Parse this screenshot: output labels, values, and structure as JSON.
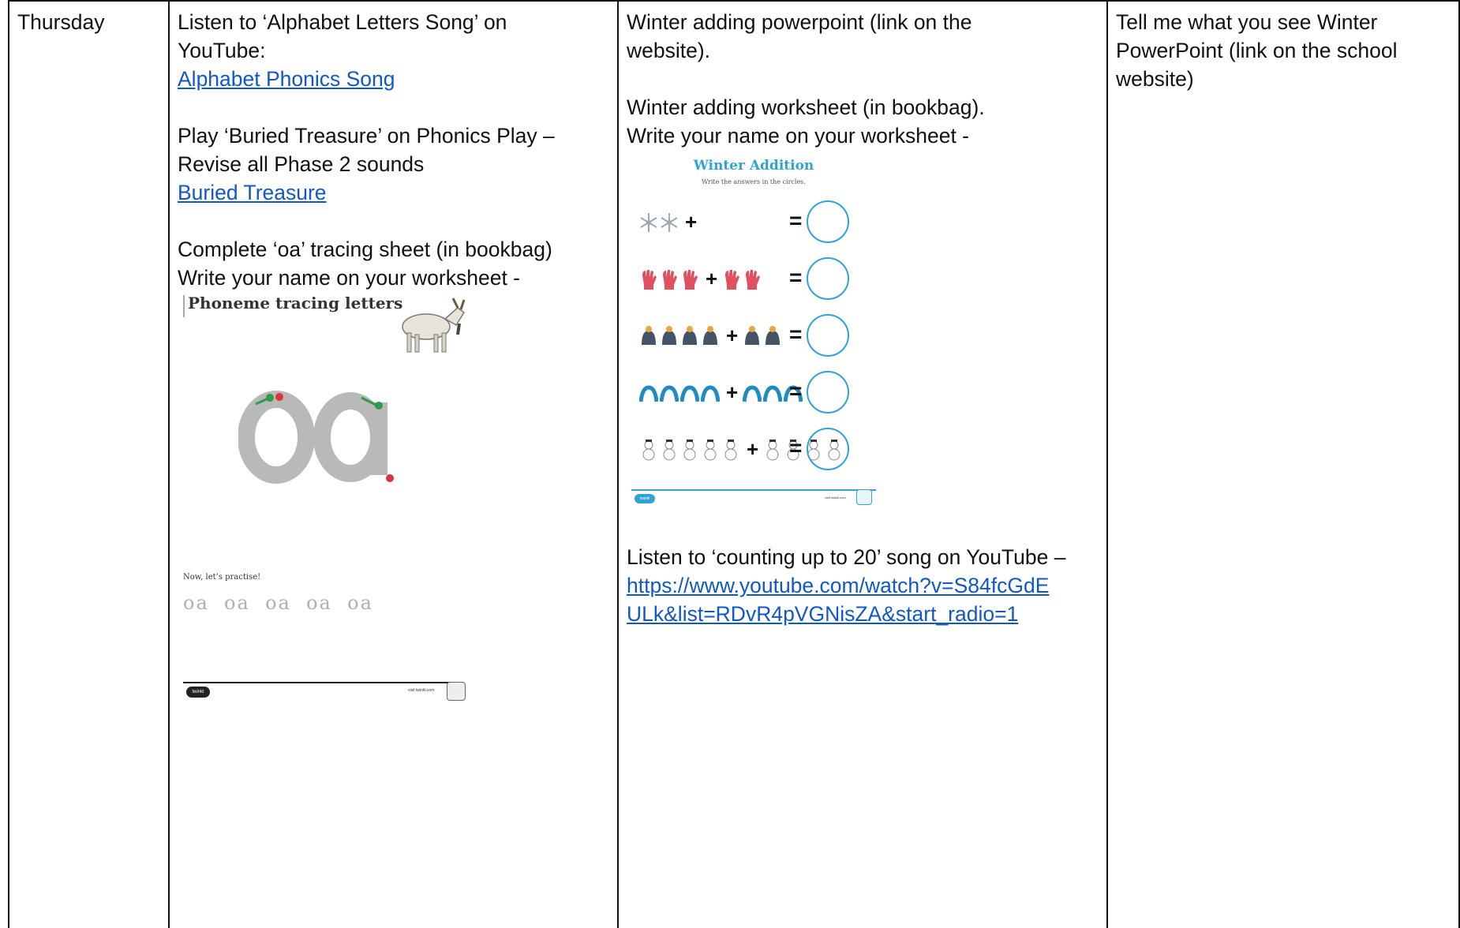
{
  "day": "Thursday",
  "phonics": {
    "line1": "Listen to ‘Alphabet Letters Song’ on",
    "line2": "YouTube:",
    "link1": "Alphabet Phonics Song",
    "line3": "Play ‘Buried Treasure’ on Phonics Play –",
    "line4": "Revise all Phase 2 sounds",
    "link2": "Buried Treasure",
    "line5": "Complete ‘oa’ tracing sheet (in bookbag)",
    "line6": "Write your name on your worksheet -",
    "sheet": {
      "title": "Phoneme tracing letters",
      "big_letters": "oa",
      "practise": "Now, let’s practise!",
      "practise_row": [
        "oa",
        "oa",
        "oa",
        "oa",
        "oa"
      ],
      "brand": "twinkl",
      "footer": "visit twinkl.com"
    }
  },
  "maths": {
    "line1": "Winter adding powerpoint (link on the",
    "line2": "website).",
    "line3": "Winter adding worksheet (in bookbag).",
    "line4": "Write your name on your worksheet -",
    "sheet": {
      "title": "Winter Addition",
      "subtitle": "Write the answers in the circles.",
      "rows": [
        {
          "a": 2,
          "b": 0,
          "icon": "snowflake-icon",
          "color": "#9ea7b4"
        },
        {
          "a": 3,
          "b": 2,
          "icon": "glove-icon",
          "color": "#e0505e"
        },
        {
          "a": 4,
          "b": 2,
          "icon": "hat-icon",
          "color": "#425466"
        },
        {
          "a": 4,
          "b": 3,
          "icon": "scarf-icon",
          "color": "#1e8cc0"
        },
        {
          "a": 5,
          "b": 4,
          "icon": "snowman-icon",
          "color": "#8a8a8a"
        }
      ],
      "plus": "+",
      "equals": "=",
      "brand": "twinkl",
      "footer": "visit twinkl.com",
      "accent": "#2fa3d6"
    },
    "line5": "Listen to ‘counting up to 20’ song on YouTube –",
    "url_line1": "https://www.youtube.com/watch?v=S84fcGdE",
    "url_line2": "ULk&list=RDvR4pVGNisZA&start_radio=1"
  },
  "topic": {
    "line1": "Tell me what you see Winter",
    "line2": "PowerPoint (link on the school",
    "line3": "website)"
  },
  "colors": {
    "link": "#1158c7",
    "border": "#111111",
    "tracing_grey": "#b9b9b9"
  }
}
